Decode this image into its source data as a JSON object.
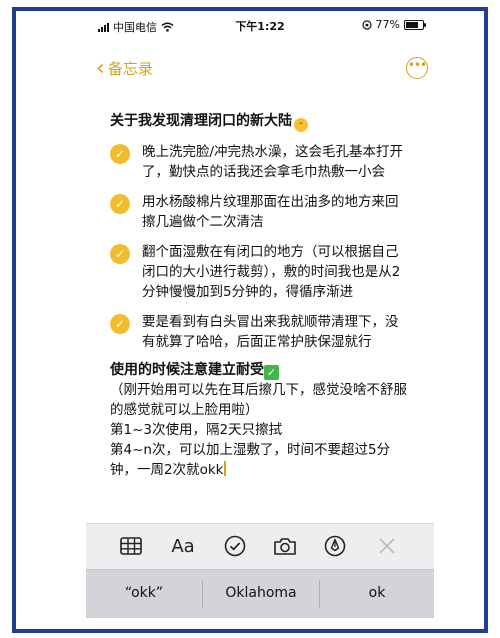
{
  "status": {
    "carrier": "中国电信",
    "time": "下午1:22",
    "battery": "77%",
    "battery_level": 0.77
  },
  "nav": {
    "back_label": "备忘录",
    "back_icon": "chevron-left-icon",
    "more_icon": "ellipsis-circle-icon"
  },
  "note": {
    "title": "关于我发现清理闭口的新大陆",
    "title_emoji": "grinning-face-icon",
    "items": [
      "晚上洗完脸/冲完热水澡，这会毛孔基本打开了，勤快点的话我还会拿毛巾热敷一小会",
      "用水杨酸棉片纹理那面在出油多的地方来回擦几遍做个二次清洁",
      "翻个面湿敷在有闭口的地方（可以根据自己闭口的大小进行裁剪），敷的时间我也是从2分钟慢慢加到5分钟的，得循序渐进",
      "要是看到有白头冒出来我就顺带清理下，没有就算了哈哈，后面正常护肤保湿就行"
    ],
    "subtitle": "使用的时候注意建立耐受",
    "para1": "（刚开始用可以先在耳后擦几下，感觉没啥不舒服的感觉就可以上脸用啦）",
    "para2": "第1~3次使用，隔2天只擦拭",
    "para3": "第4~n次，可以加上湿敷了，时间不要超过5分钟，一周2次就okk"
  },
  "toolbar": {
    "table_icon": "table-icon",
    "format_label": "Aa",
    "checklist_icon": "checklist-icon",
    "camera_icon": "camera-icon",
    "markup_icon": "markup-pen-icon",
    "close_icon": "close-icon"
  },
  "suggestions": [
    "“okk”",
    "Oklahoma",
    "ok"
  ],
  "colors": {
    "accent": "#d4a21a",
    "check": "#f2bd2c",
    "frame": "#1f3f8f",
    "green": "#3fb84a"
  }
}
